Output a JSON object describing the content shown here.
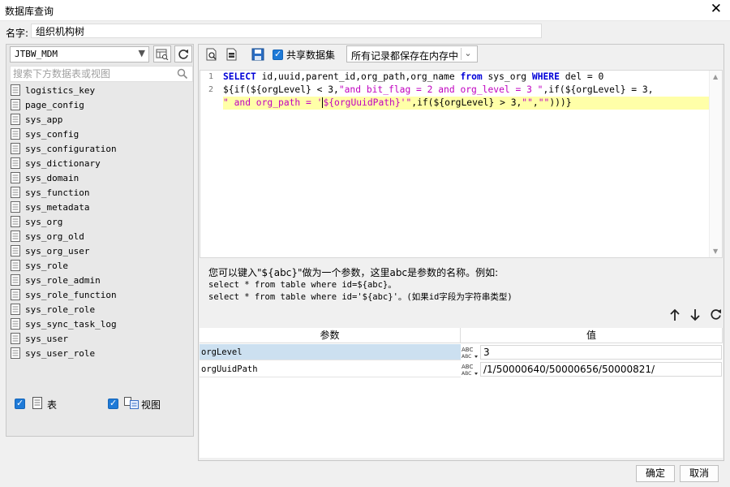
{
  "window": {
    "title": "数据库查询"
  },
  "name_field": {
    "label": "名字:",
    "value": "组织机构树"
  },
  "left_panel": {
    "datasource": "JTBW_MDM",
    "search_placeholder": "搜索下方数据表或视图",
    "tables": [
      "logistics_key",
      "page_config",
      "sys_app",
      "sys_config",
      "sys_configuration",
      "sys_dictionary",
      "sys_domain",
      "sys_function",
      "sys_metadata",
      "sys_org",
      "sys_org_old",
      "sys_org_user",
      "sys_role",
      "sys_role_admin",
      "sys_role_function",
      "sys_role_role",
      "sys_sync_task_log",
      "sys_user",
      "sys_user_role"
    ],
    "filter_table": {
      "label": "表",
      "checked": true
    },
    "filter_view": {
      "label": "视图",
      "checked": true
    }
  },
  "toolbar": {
    "share_label": "共享数据集",
    "share_checked": true,
    "mode_value": "所有记录都保存在内存中"
  },
  "editor": {
    "line_numbers": [
      "1",
      "2"
    ],
    "code_text": "SELECT id,uuid,parent_id,org_path,org_name from sys_org WHERE del = 0\n${if(${orgLevel} < 3,\"and bit_flag = 2 and org_level = 3 \",if(${orgLevel} = 3,\n\" and org_path = '${orgUuidPath}'\",if(${orgLevel} > 3,\"\",\"\")))}"
  },
  "hint": {
    "line1": "您可以键入\"${abc}\"做为一个参数，这里abc是参数的名称。例如:",
    "line2": "select * from table where id=${abc}。",
    "line3": "select * from table where id='${abc}'。(如果id字段为字符串类型)"
  },
  "params": {
    "col_name": "参数",
    "col_value": "值",
    "rows": [
      {
        "name": "orgLevel",
        "value": "3"
      },
      {
        "name": "orgUuidPath",
        "value": "/1/50000640/50000656/50000821/"
      }
    ]
  },
  "footer": {
    "ok_label": "确定",
    "cancel_label": "取消"
  },
  "colors": {
    "keyword": "#0000d8",
    "string": "#c000c0",
    "line_highlight": "#ffffa8",
    "selected_row": "#cce0f0",
    "checkbox": "#1e7ad7"
  }
}
